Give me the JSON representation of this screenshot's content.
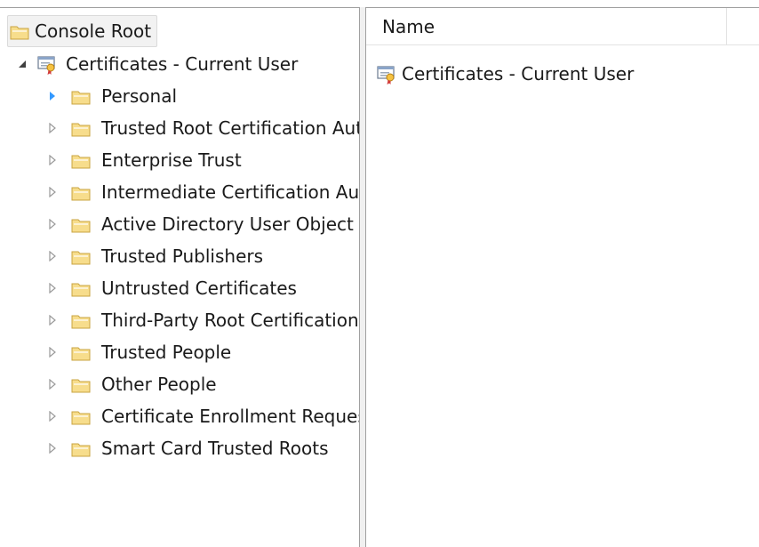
{
  "tree": {
    "root": {
      "label": "Console Root"
    },
    "certs_node": {
      "label": "Certificates - Current User",
      "expanded": true
    },
    "stores": [
      {
        "label": "Personal",
        "hovered": true
      },
      {
        "label": "Trusted Root Certification Authorities"
      },
      {
        "label": "Enterprise Trust"
      },
      {
        "label": "Intermediate Certification Authorities"
      },
      {
        "label": "Active Directory User Object"
      },
      {
        "label": "Trusted Publishers"
      },
      {
        "label": "Untrusted Certificates"
      },
      {
        "label": "Third-Party Root Certification Authorities"
      },
      {
        "label": "Trusted People"
      },
      {
        "label": "Other People"
      },
      {
        "label": "Certificate Enrollment Requests"
      },
      {
        "label": "Smart Card Trusted Roots"
      }
    ]
  },
  "list": {
    "columns": [
      {
        "label": "Name"
      }
    ],
    "items": [
      {
        "label": "Certificates - Current User",
        "icon": "certificate-store-icon"
      }
    ]
  },
  "colors": {
    "folder_fill": "#f7dd8c",
    "folder_stroke": "#c9a440",
    "expander_hover": "#3399ff",
    "expander_normal": "#9a9a9a",
    "border": "#a0a0a0"
  }
}
